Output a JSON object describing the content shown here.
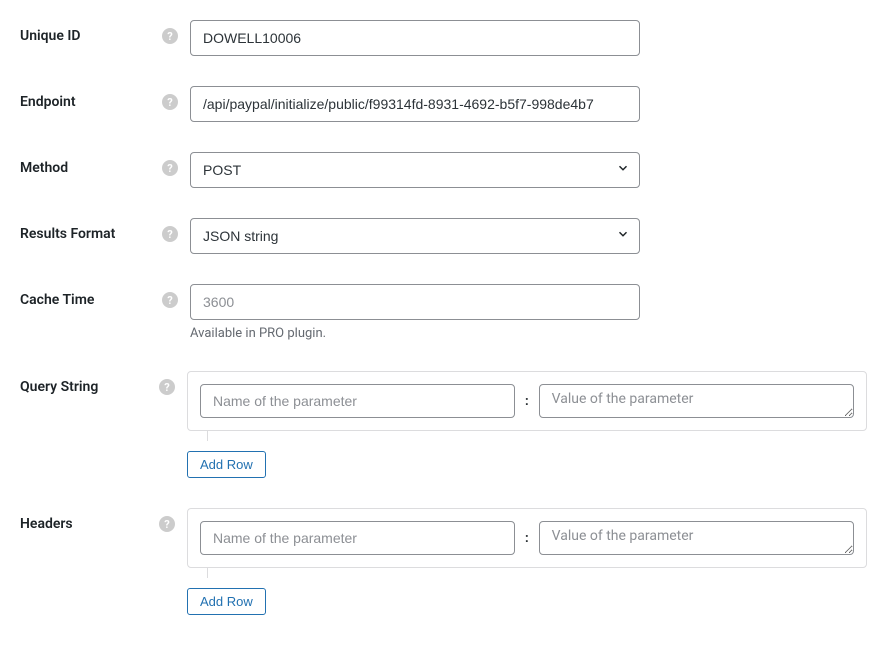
{
  "fields": {
    "unique_id": {
      "label": "Unique ID",
      "value": "DOWELL10006"
    },
    "endpoint": {
      "label": "Endpoint",
      "value": "/api/paypal/initialize/public/f99314fd-8931-4692-b5f7-998de4b7"
    },
    "method": {
      "label": "Method",
      "value": "POST"
    },
    "results_format": {
      "label": "Results Format",
      "value": "JSON string"
    },
    "cache_time": {
      "label": "Cache Time",
      "placeholder": "3600",
      "value": "",
      "help_text": "Available in PRO plugin."
    },
    "query_string": {
      "label": "Query String",
      "param_name_placeholder": "Name of the parameter",
      "param_value_placeholder": "Value of the parameter",
      "add_row_label": "Add Row"
    },
    "headers": {
      "label": "Headers",
      "param_name_placeholder": "Name of the parameter",
      "param_value_placeholder": "Value of the parameter",
      "add_row_label": "Add Row"
    }
  },
  "help_icon_char": "?"
}
